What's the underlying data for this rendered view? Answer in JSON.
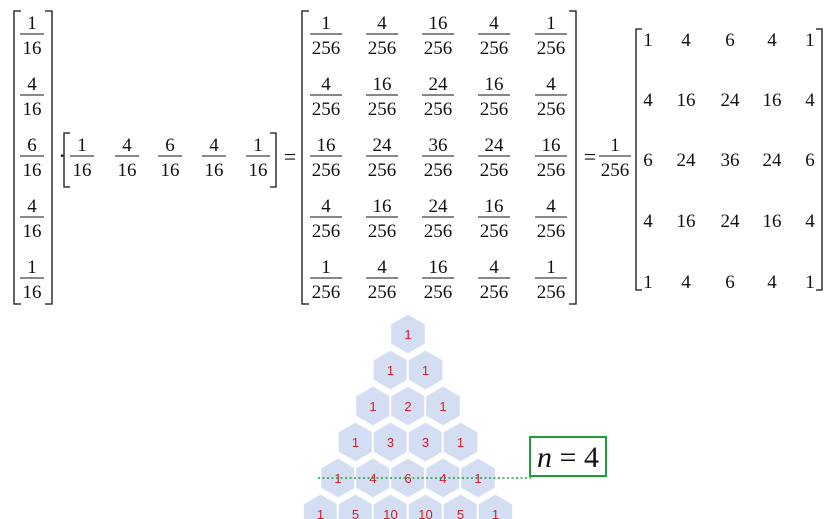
{
  "equation": {
    "column_vector": [
      {
        "num": "1",
        "den": "16"
      },
      {
        "num": "4",
        "den": "16"
      },
      {
        "num": "6",
        "den": "16"
      },
      {
        "num": "4",
        "den": "16"
      },
      {
        "num": "1",
        "den": "16"
      }
    ],
    "dot": "·",
    "row_vector": [
      {
        "num": "1",
        "den": "16"
      },
      {
        "num": "4",
        "den": "16"
      },
      {
        "num": "6",
        "den": "16"
      },
      {
        "num": "4",
        "den": "16"
      },
      {
        "num": "1",
        "den": "16"
      }
    ],
    "equals": "=",
    "product_matrix": [
      [
        {
          "num": "1",
          "den": "256"
        },
        {
          "num": "4",
          "den": "256"
        },
        {
          "num": "16",
          "den": "256"
        },
        {
          "num": "4",
          "den": "256"
        },
        {
          "num": "1",
          "den": "256"
        }
      ],
      [
        {
          "num": "4",
          "den": "256"
        },
        {
          "num": "16",
          "den": "256"
        },
        {
          "num": "24",
          "den": "256"
        },
        {
          "num": "16",
          "den": "256"
        },
        {
          "num": "4",
          "den": "256"
        }
      ],
      [
        {
          "num": "16",
          "den": "256"
        },
        {
          "num": "24",
          "den": "256"
        },
        {
          "num": "36",
          "den": "256"
        },
        {
          "num": "24",
          "den": "256"
        },
        {
          "num": "16",
          "den": "256"
        }
      ],
      [
        {
          "num": "4",
          "den": "256"
        },
        {
          "num": "16",
          "den": "256"
        },
        {
          "num": "24",
          "den": "256"
        },
        {
          "num": "16",
          "den": "256"
        },
        {
          "num": "4",
          "den": "256"
        }
      ],
      [
        {
          "num": "1",
          "den": "256"
        },
        {
          "num": "4",
          "den": "256"
        },
        {
          "num": "16",
          "den": "256"
        },
        {
          "num": "4",
          "den": "256"
        },
        {
          "num": "1",
          "den": "256"
        }
      ]
    ],
    "scalar": {
      "num": "1",
      "den": "256"
    },
    "integer_matrix": [
      [
        "1",
        "4",
        "6",
        "4",
        "1"
      ],
      [
        "4",
        "16",
        "24",
        "16",
        "4"
      ],
      [
        "6",
        "24",
        "36",
        "24",
        "6"
      ],
      [
        "4",
        "16",
        "24",
        "16",
        "4"
      ],
      [
        "1",
        "4",
        "6",
        "4",
        "1"
      ]
    ]
  },
  "pascal": {
    "rows": [
      [
        "1"
      ],
      [
        "1",
        "1"
      ],
      [
        "1",
        "2",
        "1"
      ],
      [
        "1",
        "3",
        "3",
        "1"
      ],
      [
        "1",
        "4",
        "6",
        "4",
        "1"
      ],
      [
        "1",
        "5",
        "10",
        "10",
        "5",
        "1"
      ]
    ],
    "highlight_label": "n = 4",
    "colors": {
      "hex_fill": "#d3def2",
      "number": "#d01e2a",
      "guide": "#1e9e3a",
      "box": "#1e9e3a"
    }
  }
}
